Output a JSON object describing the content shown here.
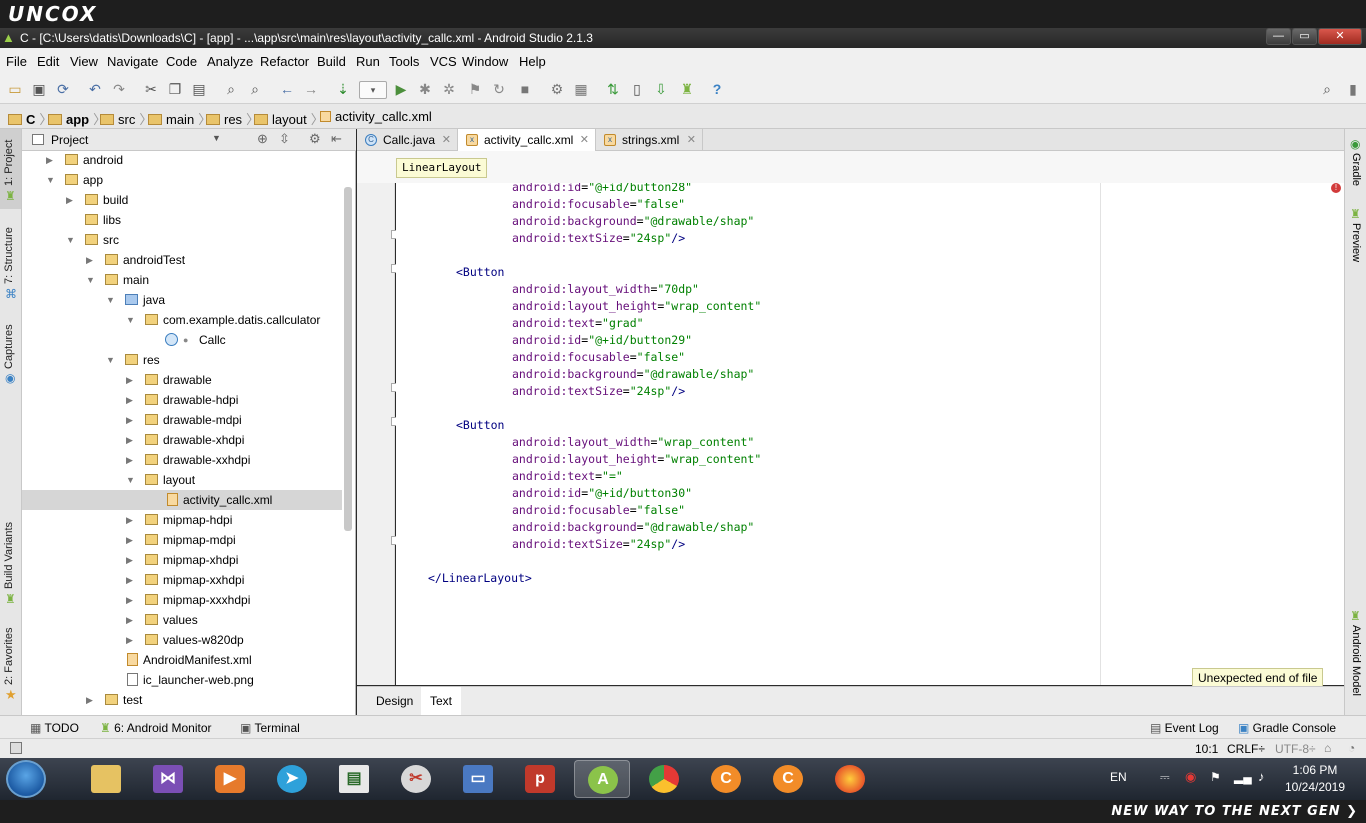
{
  "brand": {
    "logo": "UNCOX",
    "slogan": "NEW WAY TO THE NEXT GEN ❯"
  },
  "window": {
    "title": "C - [C:\\Users\\datis\\Downloads\\C] - [app] - ...\\app\\src\\main\\res\\layout\\activity_callc.xml - Android Studio 2.1.3",
    "min": "—",
    "max": "▭",
    "close": "✕"
  },
  "menu": [
    "File",
    "Edit",
    "View",
    "Navigate",
    "Code",
    "Analyze",
    "Refactor",
    "Build",
    "Run",
    "Tools",
    "VCS",
    "Window",
    "Help"
  ],
  "breadcrumbs": [
    "C",
    "app",
    "src",
    "main",
    "res",
    "layout",
    "activity_callc.xml"
  ],
  "left_stripe": {
    "project": "1: Project",
    "structure": "7: Structure",
    "captures": "Captures",
    "build_variants": "Build Variants",
    "favorites": "2: Favorites"
  },
  "project_panel": {
    "title": "Project",
    "tree": [
      {
        "label": "android"
      },
      {
        "label": "app"
      },
      {
        "label": "build"
      },
      {
        "label": "libs"
      },
      {
        "label": "src"
      },
      {
        "label": "androidTest"
      },
      {
        "label": "main"
      },
      {
        "label": "java"
      },
      {
        "label": "com.example.datis.callculator"
      },
      {
        "label": "Callc"
      },
      {
        "label": "res"
      },
      {
        "label": "drawable"
      },
      {
        "label": "drawable-hdpi"
      },
      {
        "label": "drawable-mdpi"
      },
      {
        "label": "drawable-xhdpi"
      },
      {
        "label": "drawable-xxhdpi"
      },
      {
        "label": "layout"
      },
      {
        "label": "activity_callc.xml"
      },
      {
        "label": "mipmap-hdpi"
      },
      {
        "label": "mipmap-mdpi"
      },
      {
        "label": "mipmap-xhdpi"
      },
      {
        "label": "mipmap-xxhdpi"
      },
      {
        "label": "mipmap-xxxhdpi"
      },
      {
        "label": "values"
      },
      {
        "label": "values-w820dp"
      },
      {
        "label": "AndroidManifest.xml"
      },
      {
        "label": "ic_launcher-web.png"
      },
      {
        "label": "test"
      }
    ]
  },
  "editor": {
    "tabs": [
      {
        "label": "Callc.java",
        "icon": "C"
      },
      {
        "label": "activity_callc.xml",
        "icon": "x"
      },
      {
        "label": "strings.xml",
        "icon": "x"
      }
    ],
    "tab_close": "✕",
    "path_tag": "LinearLayout",
    "code": [
      {
        "ind": "        ",
        "attr": "android:id",
        "eq": "=",
        "val": "\"@+id/button28\"",
        "tail": ""
      },
      {
        "ind": "        ",
        "attr": "android:focusable",
        "eq": "=",
        "val": "\"false\"",
        "tail": ""
      },
      {
        "ind": "        ",
        "attr": "android:background",
        "eq": "=",
        "val": "\"@drawable/shap\"",
        "tail": ""
      },
      {
        "ind": "        ",
        "attr": "android:textSize",
        "eq": "=",
        "val": "\"24sp\"",
        "tail": "/>"
      },
      {
        "ind": "",
        "attr": "",
        "eq": "",
        "val": "",
        "tail": ""
      },
      {
        "ind": "    ",
        "attr": "",
        "eq": "",
        "val": "",
        "tail": "<Button"
      },
      {
        "ind": "        ",
        "attr": "android:layout_width",
        "eq": "=",
        "val": "\"70dp\"",
        "tail": ""
      },
      {
        "ind": "        ",
        "attr": "android:layout_height",
        "eq": "=",
        "val": "\"wrap_content\"",
        "tail": ""
      },
      {
        "ind": "        ",
        "attr": "android:text",
        "eq": "=",
        "val": "\"grad\"",
        "tail": ""
      },
      {
        "ind": "        ",
        "attr": "android:id",
        "eq": "=",
        "val": "\"@+id/button29\"",
        "tail": ""
      },
      {
        "ind": "        ",
        "attr": "android:focusable",
        "eq": "=",
        "val": "\"false\"",
        "tail": ""
      },
      {
        "ind": "        ",
        "attr": "android:background",
        "eq": "=",
        "val": "\"@drawable/shap\"",
        "tail": ""
      },
      {
        "ind": "        ",
        "attr": "android:textSize",
        "eq": "=",
        "val": "\"24sp\"",
        "tail": "/>"
      },
      {
        "ind": "",
        "attr": "",
        "eq": "",
        "val": "",
        "tail": ""
      },
      {
        "ind": "    ",
        "attr": "",
        "eq": "",
        "val": "",
        "tail": "<Button"
      },
      {
        "ind": "        ",
        "attr": "android:layout_width",
        "eq": "=",
        "val": "\"wrap_content\"",
        "tail": ""
      },
      {
        "ind": "        ",
        "attr": "android:layout_height",
        "eq": "=",
        "val": "\"wrap_content\"",
        "tail": ""
      },
      {
        "ind": "        ",
        "attr": "android:text",
        "eq": "=",
        "val": "\"=\"",
        "tail": ""
      },
      {
        "ind": "        ",
        "attr": "android:id",
        "eq": "=",
        "val": "\"@+id/button30\"",
        "tail": ""
      },
      {
        "ind": "        ",
        "attr": "android:focusable",
        "eq": "=",
        "val": "\"false\"",
        "tail": ""
      },
      {
        "ind": "        ",
        "attr": "android:background",
        "eq": "=",
        "val": "\"@drawable/shap\"",
        "tail": ""
      },
      {
        "ind": "        ",
        "attr": "android:textSize",
        "eq": "=",
        "val": "\"24sp\"",
        "tail": "/>"
      },
      {
        "ind": "",
        "attr": "",
        "eq": "",
        "val": "",
        "tail": ""
      },
      {
        "ind": "",
        "attr": "",
        "eq": "",
        "val": "",
        "tail": "</LinearLayout>"
      }
    ],
    "error_tooltip": "Unexpected end of file",
    "design_tab": "Design",
    "text_tab": "Text"
  },
  "right_stripe": {
    "gradle": "Gradle",
    "preview": "Preview",
    "android_model": "Android Model"
  },
  "bottom_tools": {
    "todo": "TODO",
    "android_monitor": "6: Android Monitor",
    "terminal": "Terminal",
    "event_log": "Event Log",
    "gradle_console": "Gradle Console"
  },
  "status": {
    "position": "10:1",
    "line_sep": "CRLF÷",
    "encoding": "UTF-8÷"
  },
  "taskbar": {
    "lang": "EN",
    "time": "1:06 PM",
    "date": "10/24/2019"
  },
  "colors": {
    "accent": "#3b82c4",
    "attr": "#660e7a",
    "value": "#008000",
    "tag": "#000080"
  }
}
